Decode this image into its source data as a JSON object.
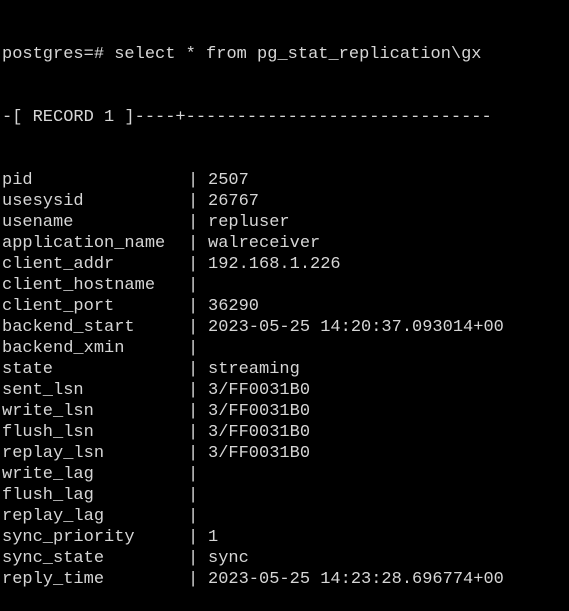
{
  "prompt": "postgres=#",
  "command": "select * from pg_stat_replication\\gx",
  "record_header": "-[ RECORD 1 ]----+------------------------------",
  "rows": [
    {
      "field": "pid",
      "value": "2507"
    },
    {
      "field": "usesysid",
      "value": "26767"
    },
    {
      "field": "usename",
      "value": "repluser"
    },
    {
      "field": "application_name",
      "value": "walreceiver"
    },
    {
      "field": "client_addr",
      "value": "192.168.1.226"
    },
    {
      "field": "client_hostname",
      "value": ""
    },
    {
      "field": "client_port",
      "value": "36290"
    },
    {
      "field": "backend_start",
      "value": "2023-05-25 14:20:37.093014+00"
    },
    {
      "field": "backend_xmin",
      "value": ""
    },
    {
      "field": "state",
      "value": "streaming"
    },
    {
      "field": "sent_lsn",
      "value": "3/FF0031B0"
    },
    {
      "field": "write_lsn",
      "value": "3/FF0031B0"
    },
    {
      "field": "flush_lsn",
      "value": "3/FF0031B0"
    },
    {
      "field": "replay_lsn",
      "value": "3/FF0031B0"
    },
    {
      "field": "write_lag",
      "value": ""
    },
    {
      "field": "flush_lag",
      "value": ""
    },
    {
      "field": "replay_lag",
      "value": ""
    },
    {
      "field": "sync_priority",
      "value": "1"
    },
    {
      "field": "sync_state",
      "value": "sync"
    },
    {
      "field": "reply_time",
      "value": "2023-05-25 14:23:28.696774+00"
    }
  ],
  "separator": "|"
}
